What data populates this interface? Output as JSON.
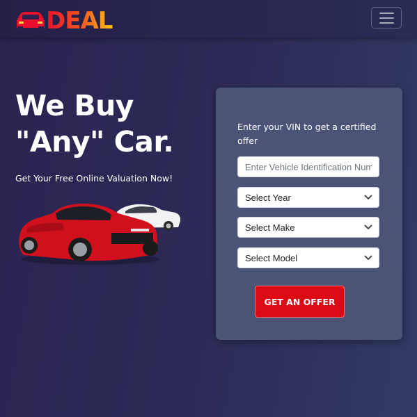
{
  "navbar": {
    "logo_text": "DEAL",
    "logo_icon": "car-icon",
    "menu_icon": "hamburger-menu-icon"
  },
  "hero": {
    "title_line1": "We Buy",
    "title_line2": "\"Any\" Car.",
    "subtitle": "Get Your Free Online Valuation Now!"
  },
  "form": {
    "title": "Enter your VIN to get a certified offer",
    "vin_placeholder": "Enter Vehicle Identification Number",
    "vin_value": "",
    "year_select": "Select Year",
    "make_select": "Select Make",
    "model_select": "Select Model",
    "submit_label": "GET AN OFFER"
  },
  "colors": {
    "accent_red": "#dc0a14",
    "card_bg": "#4b5377",
    "logo_gradient_start": "#e8102e",
    "logo_gradient_end": "#ffc21a"
  }
}
